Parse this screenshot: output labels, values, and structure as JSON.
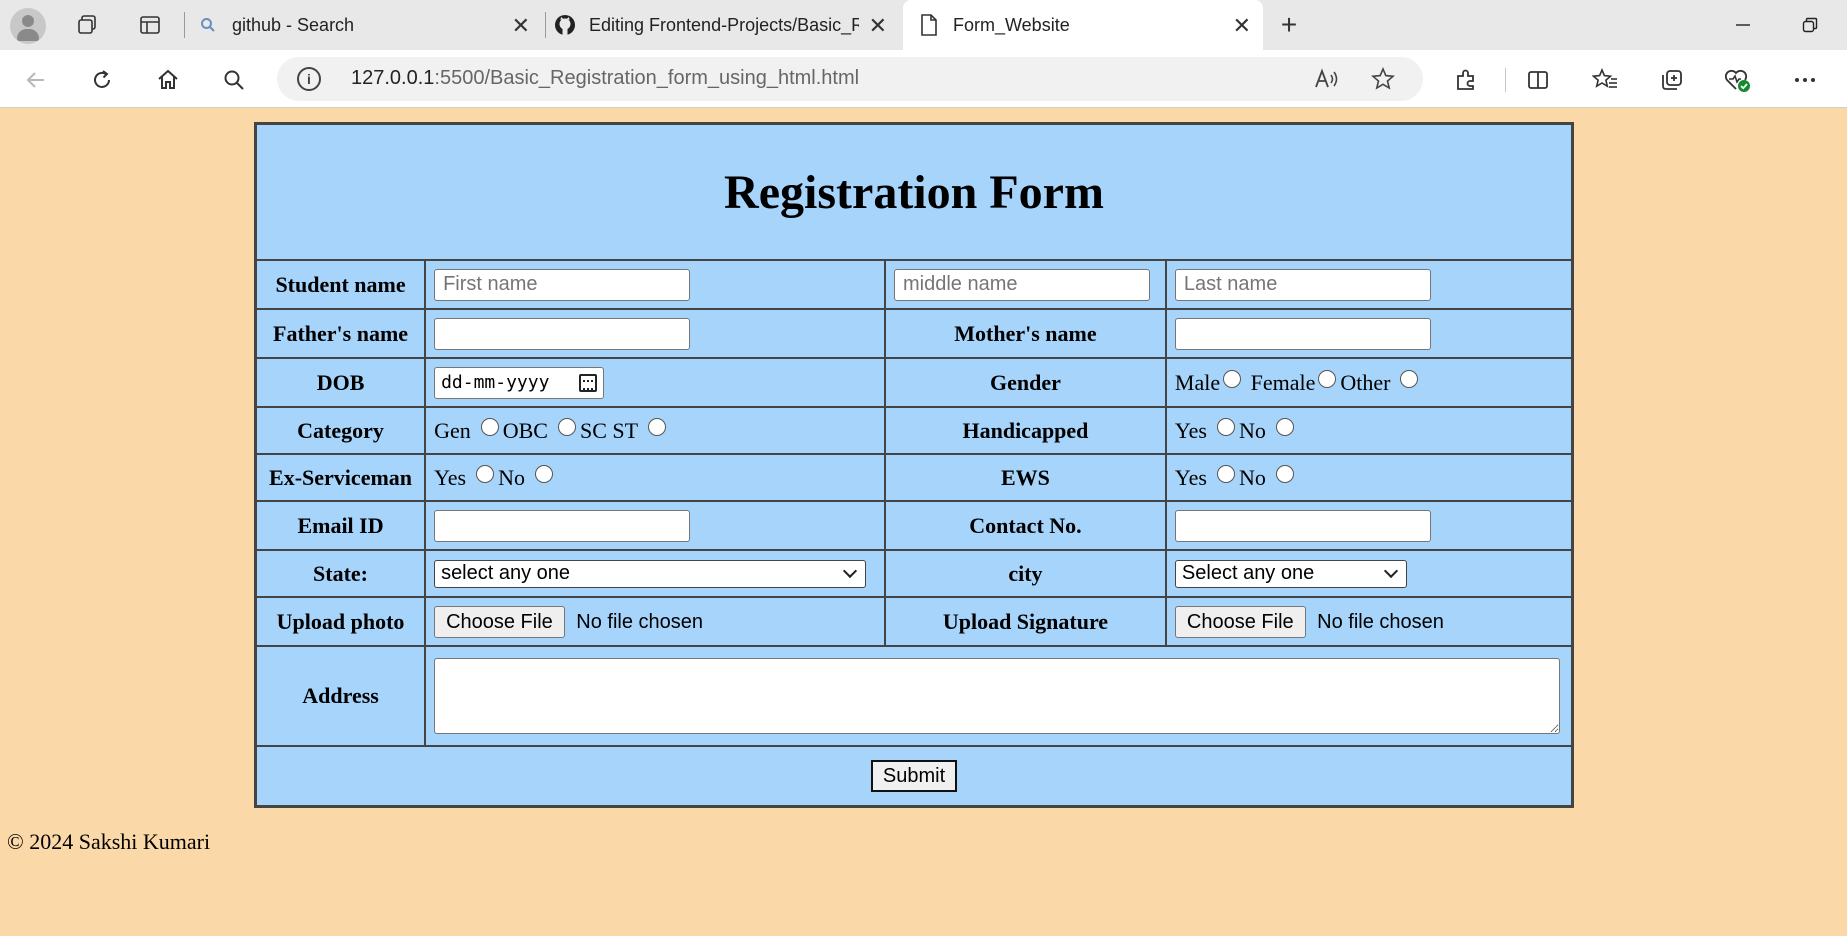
{
  "browser": {
    "tabs": [
      {
        "title": "github - Search",
        "icon": "search-icon"
      },
      {
        "title": "Editing Frontend-Projects/Basic_R",
        "icon": "github-icon"
      },
      {
        "title": "Form_Website",
        "icon": "page-icon",
        "active": true
      }
    ],
    "url_host": "127.0.0.1",
    "url_path": ":5500/Basic_Registration_form_using_html.html"
  },
  "form": {
    "title": "Registration Form",
    "student_label": "Student name",
    "first_placeholder": "First name",
    "middle_placeholder": "middle name",
    "last_placeholder": "Last name",
    "father_label": "Father's name",
    "mother_label": "Mother's name",
    "dob_label": "DOB",
    "dob_placeholder": "dd-mm-yyyy",
    "gender_label": "Gender",
    "gender_options": [
      "Male",
      "Female",
      "Other"
    ],
    "category_label": "Category",
    "category_options": [
      "Gen",
      "OBC",
      "SC ST"
    ],
    "handicapped_label": "Handicapped",
    "handicapped_options": [
      "Yes",
      "No"
    ],
    "exserviceman_label": "Ex-Serviceman",
    "exserviceman_options": [
      "Yes",
      "No"
    ],
    "ews_label": "EWS",
    "ews_options": [
      "Yes",
      "No"
    ],
    "email_label": "Email ID",
    "contact_label": "Contact No.",
    "state_label": "State:",
    "state_selected": "select any one",
    "city_label": "city",
    "city_selected": "Select any one",
    "photo_label": "Upload photo",
    "signature_label": "Upload Signature",
    "choose_file": "Choose File",
    "no_file": "No file chosen",
    "address_label": "Address",
    "submit_label": "Submit"
  },
  "footer": "© 2024 Sakshi Kumari",
  "colors": {
    "page_bg": "#fbd8a8",
    "form_bg": "#a6d4fb"
  }
}
